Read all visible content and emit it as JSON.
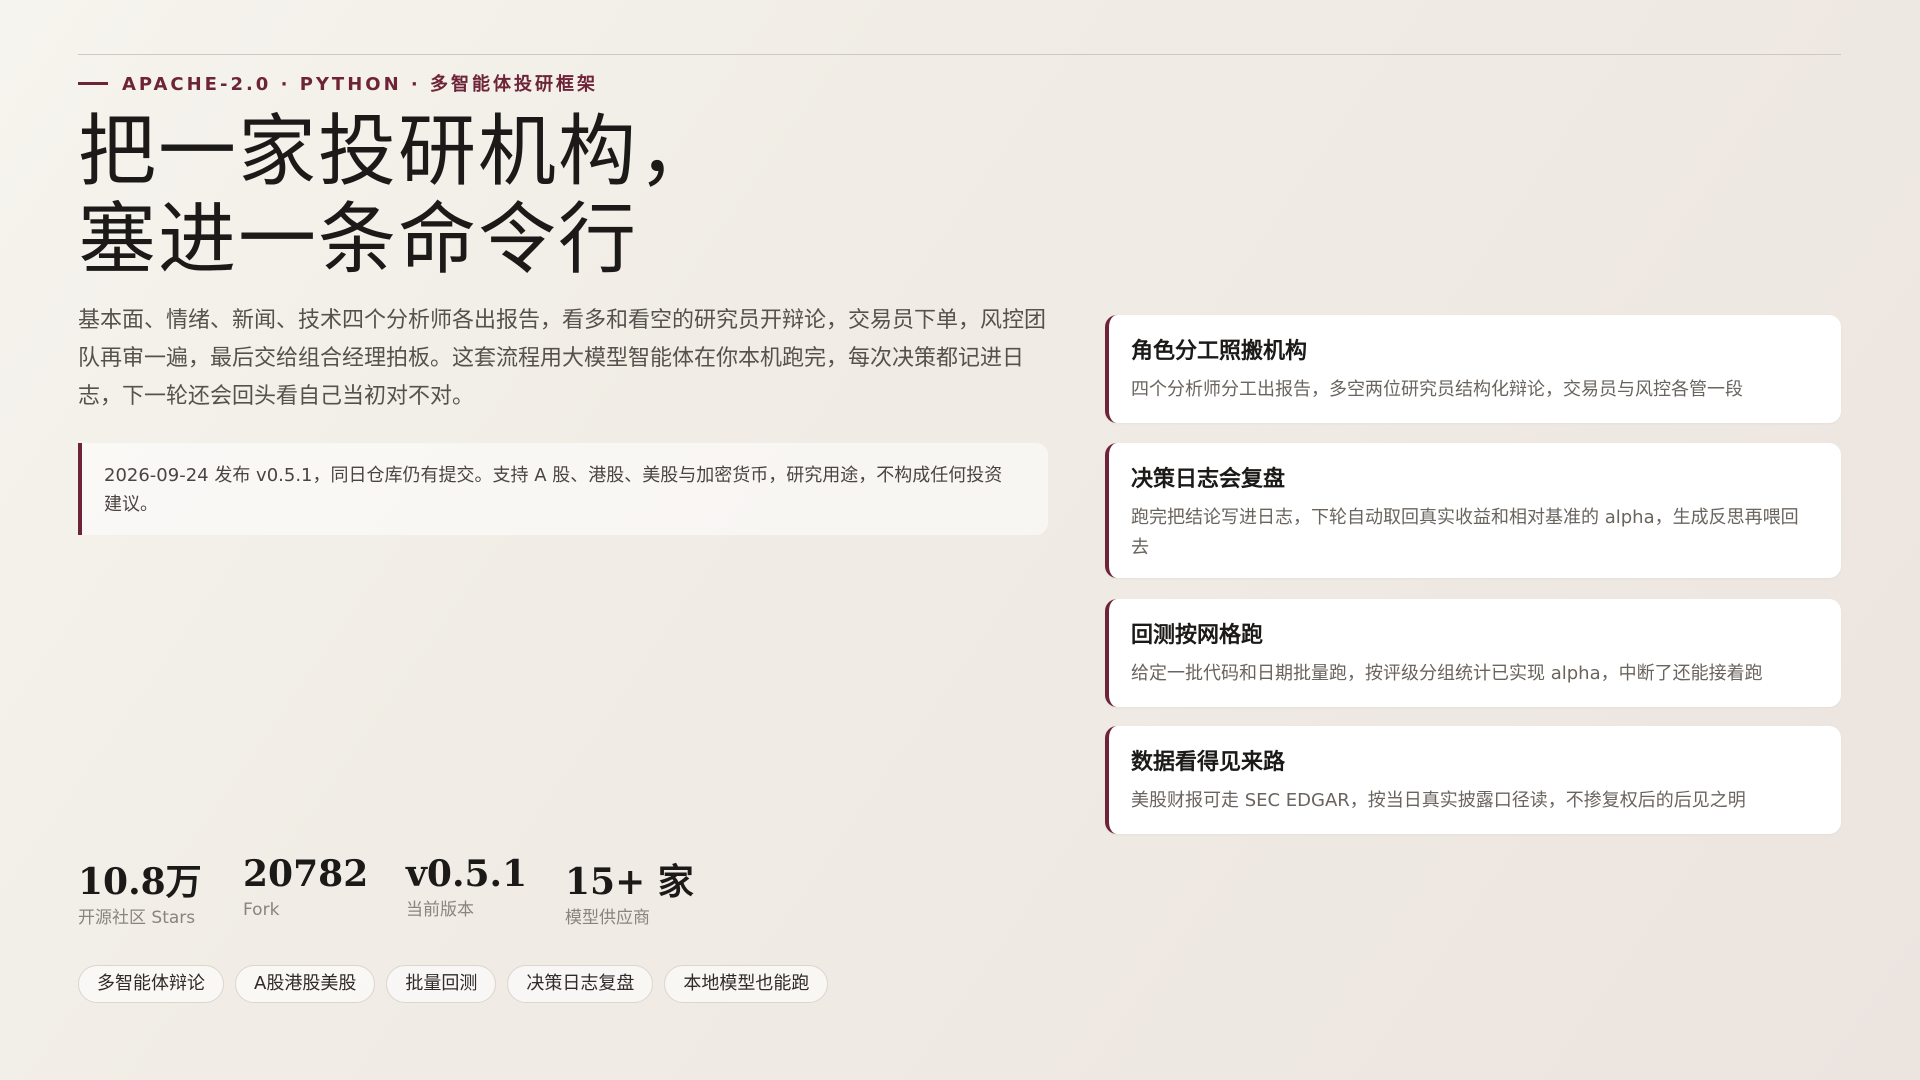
{
  "hero": {
    "eyebrow": "APACHE-2.0 · PYTHON · 多智能体投研框架",
    "headline_line1": "把一家投研机构，",
    "headline_line2": "塞进一条命令行",
    "intro": "基本面、情绪、新闻、技术四个分析师各出报告，看多和看空的研究员开辩论，交易员下单，风控团队再审一遍，最后交给组合经理拍板。这套流程用大模型智能体在你本机跑完，每次决策都记进日志，下一轮还会回头看自己当初对不对。",
    "note": "2026-09-24 发布 v0.5.1，同日仓库仍有提交。支持 A 股、港股、美股与加密货币，研究用途，不构成任何投资建议。"
  },
  "features": [
    {
      "title": "角色分工照搬机构",
      "desc": "四个分析师分工出报告，多空两位研究员结构化辩论，交易员与风控各管一段"
    },
    {
      "title": "决策日志会复盘",
      "desc": "跑完把结论写进日志，下轮自动取回真实收益和相对基准的 alpha，生成反思再喂回去"
    },
    {
      "title": "回测按网格跑",
      "desc": "给定一批代码和日期批量跑，按评级分组统计已实现 alpha，中断了还能接着跑"
    },
    {
      "title": "数据看得见来路",
      "desc": "美股财报可走 SEC EDGAR，按当日真实披露口径读，不掺复权后的后见之明"
    }
  ],
  "stats": [
    {
      "value": "10.8万",
      "label": "开源社区 Stars"
    },
    {
      "value": "20782",
      "label": "Fork"
    },
    {
      "value": "v0.5.1",
      "label": "当前版本"
    },
    {
      "value": "15+ 家",
      "label": "模型供应商"
    }
  ],
  "tags": [
    "多智能体辩论",
    "A股港股美股",
    "批量回测",
    "决策日志复盘",
    "本地模型也能跑"
  ],
  "colors": {
    "accent": "#6e2438",
    "background": "#f3efe8",
    "card": "#ffffff"
  }
}
